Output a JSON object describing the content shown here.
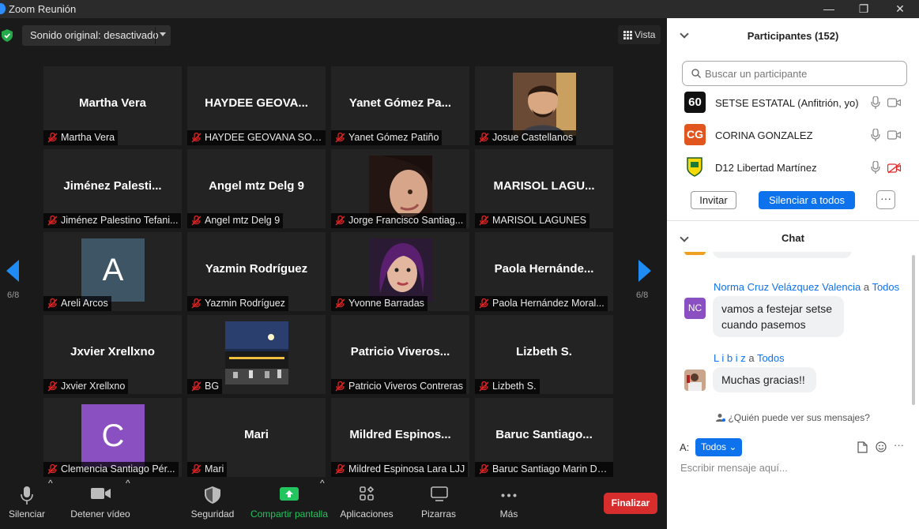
{
  "window": {
    "title": "Zoom Reunión",
    "controls": {
      "minimize": "—",
      "maximize": "❐",
      "close": "✕"
    }
  },
  "top_bar": {
    "audio_label": "Sonido original: desactivado",
    "view_label": "Vista"
  },
  "pagination": {
    "left": "6/8",
    "right": "6/8"
  },
  "tiles": [
    {
      "big": "Martha  Vera",
      "caption": "Martha  Vera"
    },
    {
      "big": "HAYDEE  GEOVA...",
      "caption": "HAYDEE GEOVANA SOT..."
    },
    {
      "big": "Yanet  Gómez  Pa...",
      "caption": "Yanet Gómez Patiño"
    },
    {
      "big": "",
      "caption": "Josue Castellanos",
      "photo": "man-smiling"
    },
    {
      "big": "Jiménez  Palesti...",
      "caption": "Jiménez Palestino Tefani..."
    },
    {
      "big": "Angel mtz Delg 9",
      "caption": "Angel mtz Delg 9"
    },
    {
      "big": "",
      "caption": "Jorge Francisco Santiag...",
      "photo": "woman-dark-hair"
    },
    {
      "big": "MARISOL  LAGU...",
      "caption": "MARISOL LAGUNES"
    },
    {
      "big": "",
      "caption": "Areli Arcos",
      "avatar_letter": "A",
      "avatar_color": "#3e5566"
    },
    {
      "big": "Yazmin Rodríguez",
      "caption": "Yazmin Rodríguez"
    },
    {
      "big": "",
      "caption": "Yvonne Barradas",
      "photo": "woman-purple"
    },
    {
      "big": "Paola  Hernánde...",
      "caption": "Paola Hernández Moral..."
    },
    {
      "big": "Jxvier Xrellxno",
      "caption": "Jxvier Xrellxno"
    },
    {
      "big": "",
      "caption": "BG",
      "photo": "night-plaza"
    },
    {
      "big": "Patricio  Viveros...",
      "caption": "Patricio Viveros Contreras"
    },
    {
      "big": "Lizbeth S.",
      "caption": "Lizbeth S."
    },
    {
      "big": "",
      "caption": "Clemencia  Santiago Pér...",
      "avatar_letter": "C",
      "avatar_color": "#8a4fc1"
    },
    {
      "big": "Mari",
      "caption": "Mari"
    },
    {
      "big": "Mildred  Espinos...",
      "caption": "Mildred Espinosa Lara LJJ"
    },
    {
      "big": "Baruc  Santiago...",
      "caption": "Baruc Santiago Marin Dele..."
    }
  ],
  "toolbar": {
    "mute": "Silenciar",
    "video": "Detener vídeo",
    "security": "Seguridad",
    "share": "Compartir pantalla",
    "apps": "Aplicaciones",
    "whiteboard": "Pizarras",
    "more": "Más",
    "end": "Finalizar",
    "share_color": "#22c55e",
    "end_color": "#d82d2d"
  },
  "participants_panel": {
    "title": "Participantes (152)",
    "search_placeholder": "Buscar un participante",
    "rows": [
      {
        "avatar": "60",
        "name": "SETSE ESTATAL (Anfitrión, yo)",
        "cam_off": false
      },
      {
        "avatar": "CG",
        "name": "CORINA GONZALEZ",
        "cam_off": false
      },
      {
        "avatar": "",
        "name": "D12 Libertad Martínez",
        "cam_off": true
      }
    ],
    "invite": "Invitar",
    "mute_all": "Silenciar a todos",
    "more": "···"
  },
  "chat": {
    "title": "Chat",
    "messages": [
      {
        "from": "Norma Cruz Velázquez Valencia",
        "to": "Todos",
        "initials": "NC",
        "text_line1": "vamos a festejar setse",
        "text_line2": "cuando pasemos"
      },
      {
        "from": "L i b i z",
        "to": "Todos",
        "initials": "",
        "text_line1": "Muchas gracias!!"
      }
    ],
    "connector": "a",
    "who_can_see": "¿Quién puede ver sus mensajes?",
    "to_label": "A:",
    "to_value": "Todos",
    "input_placeholder": "Escribir mensaje aquí...",
    "more": "···"
  }
}
